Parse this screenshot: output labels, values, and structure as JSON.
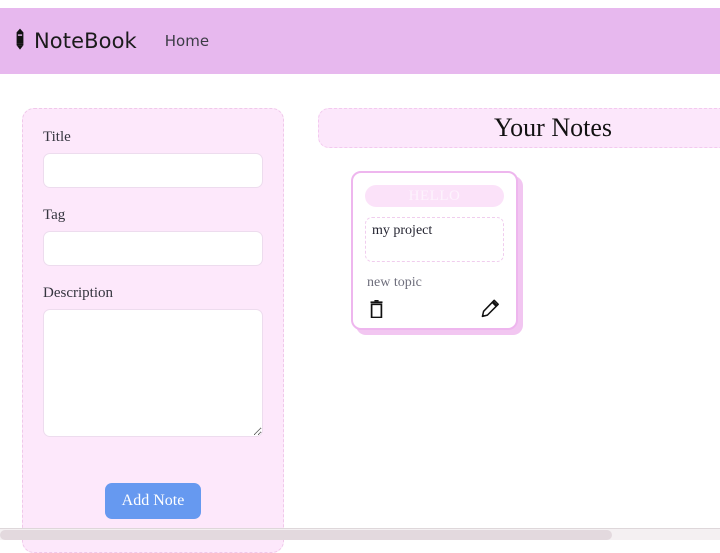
{
  "navbar": {
    "brand_icon": "pencil-icon",
    "brand": "NoteBook",
    "links": [
      {
        "label": "Home"
      }
    ],
    "background_color": "#e7b8ee"
  },
  "form_panel": {
    "fields": [
      {
        "label": "Title",
        "value": "",
        "placeholder": ""
      },
      {
        "label": "Tag",
        "value": "",
        "placeholder": ""
      },
      {
        "label": "Description",
        "value": "",
        "placeholder": ""
      }
    ],
    "submit_label": "Add Note",
    "submit_color": "#6699f0",
    "background_color": "#fde8fb"
  },
  "notes": {
    "header_title": "Your Notes",
    "header_background": "#fce7fb",
    "cards": [
      {
        "title": "HELLO",
        "description": "my project",
        "tag": "new topic",
        "delete_icon": "trash-icon",
        "edit_icon": "pencil-icon",
        "border_color": "#eeb6ee"
      }
    ]
  }
}
